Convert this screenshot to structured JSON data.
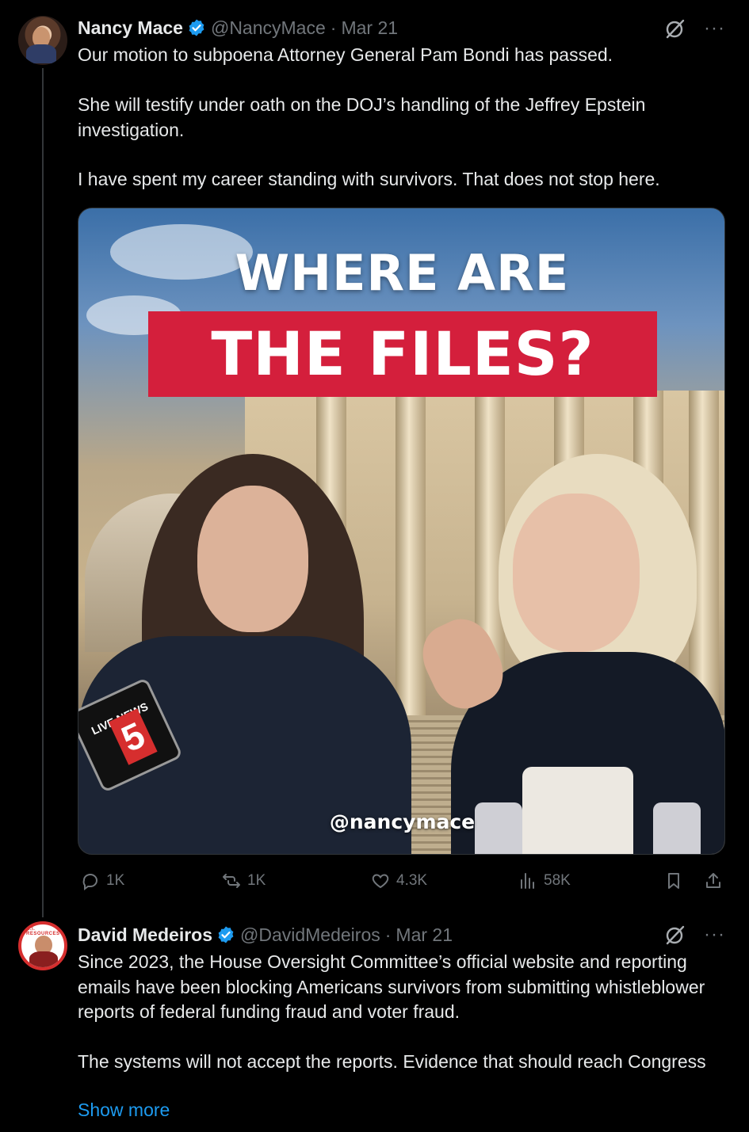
{
  "tweets": [
    {
      "name": "Nancy Mace",
      "handle": "@NancyMace",
      "date": "Mar 21",
      "paragraphs": [
        "Our motion to subpoena Attorney General Pam Bondi has passed.",
        "She will testify under oath on the DOJ’s handling of the Jeffrey Epstein investigation.",
        "I have spent my career standing with survivors. That does not stop here."
      ],
      "media": {
        "headline_top": "WHERE ARE",
        "headline_bottom": "THE FILES?",
        "watermark": "@nancymace",
        "mic_label": "LIVE NEWS",
        "mic_number": "5"
      },
      "actions": {
        "replies": "1K",
        "reposts": "1K",
        "likes": "4.3K",
        "views": "58K"
      },
      "icons": [
        "grok-icon",
        "more-icon",
        "reply-icon",
        "repost-icon",
        "like-icon",
        "views-icon",
        "bookmark-icon",
        "share-icon",
        "verified-icon"
      ]
    },
    {
      "name": "David Medeiros",
      "handle": "@DavidMedeiros",
      "date": "Mar 21",
      "paragraphs": [
        "Since 2023, the House Oversight Committee’s official website and reporting emails have been blocking Americans survivors from submitting whistleblower reports of federal funding fraud and voter fraud.",
        "The systems will not accept the reports. Evidence that should reach Congress"
      ],
      "show_more": "Show more",
      "avatar_badge": "R.I. RESOURCES"
    }
  ],
  "separator": "·",
  "more": "···",
  "colors": {
    "background": "#000000",
    "text": "#e7e9ea",
    "muted": "#71767b",
    "link": "#1d9bf0",
    "verified": "#1d9bf0",
    "headline_banner": "#d41f3c"
  }
}
